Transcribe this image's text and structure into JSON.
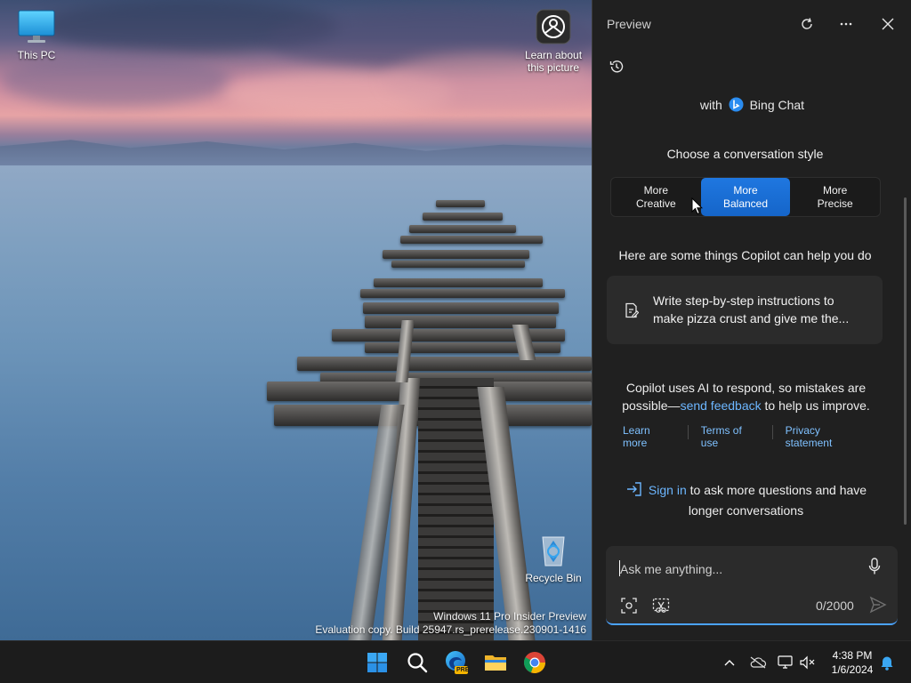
{
  "desktop": {
    "icons": {
      "this_pc": "This PC",
      "learn_picture": "Learn about\nthis picture",
      "recycle_bin": "Recycle Bin"
    },
    "watermark": {
      "line1": "Windows 11 Pro Insider Preview",
      "line2": "Evaluation copy. Build 25947.rs_prerelease.230901-1416"
    }
  },
  "panel": {
    "title": "Preview",
    "brand_prefix": "with",
    "brand_name": "Bing Chat",
    "style_title": "Choose a conversation style",
    "styles": [
      {
        "label": "More\nCreative",
        "active": false
      },
      {
        "label": "More\nBalanced",
        "active": true
      },
      {
        "label": "More\nPrecise",
        "active": false
      }
    ],
    "help_title": "Here are some things Copilot can help you do",
    "suggestion": "Write step-by-step instructions to make pizza crust and give me the...",
    "disclaimer": {
      "part1": "Copilot uses AI to respond, so mistakes are possible—",
      "link": "send feedback",
      "part2": " to help us improve."
    },
    "legal": {
      "learn_more": "Learn more",
      "terms": "Terms of use",
      "privacy": "Privacy statement"
    },
    "signin": {
      "link": "Sign in",
      "rest": " to ask more questions and have longer conversations"
    },
    "input": {
      "placeholder": "Ask me anything...",
      "value": "",
      "counter": "0/2000"
    },
    "colors": {
      "accent": "#1f77e0",
      "link": "#6cb6ff",
      "panel_bg": "#202020"
    }
  },
  "taskbar": {
    "apps": [
      "start-icon",
      "search-icon",
      "edge-beta-icon",
      "file-explorer-icon",
      "chrome-icon"
    ],
    "edge_badge": "PRE",
    "time": "4:38 PM",
    "date": "1/6/2024"
  }
}
